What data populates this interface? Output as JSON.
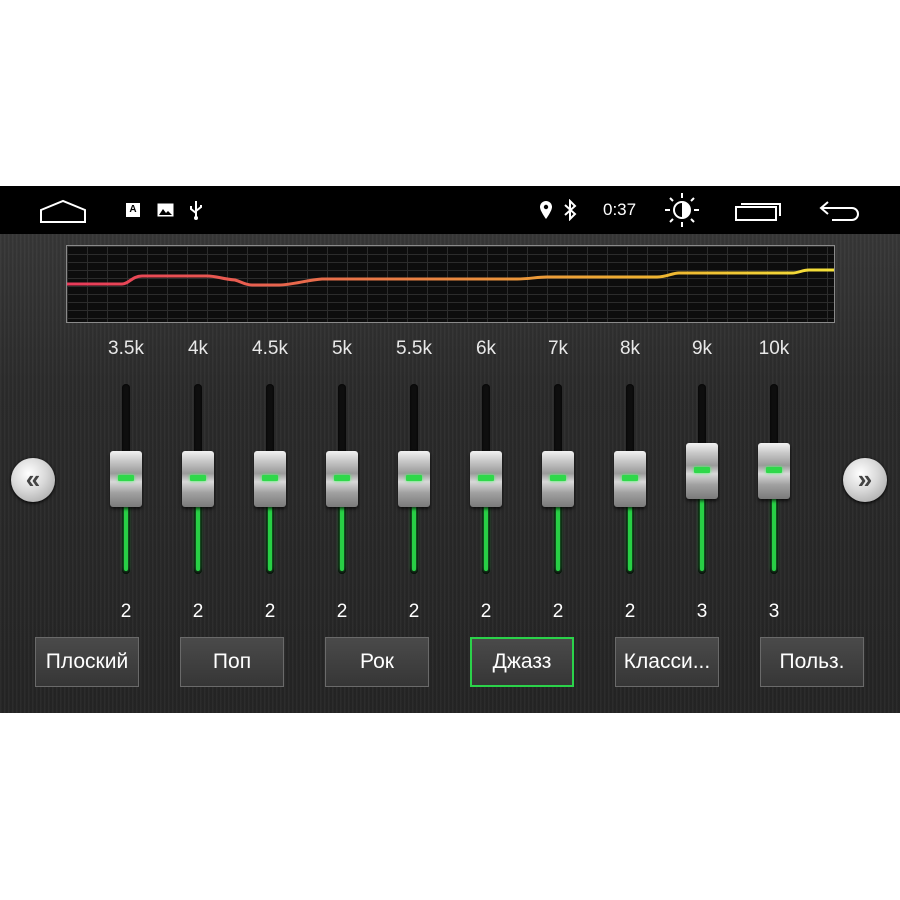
{
  "status_bar": {
    "home_icon": "home-icon",
    "notification_icons": [
      "app-a-icon",
      "image-icon",
      "usb-icon"
    ],
    "location_icon": "location-icon",
    "bluetooth_icon": "bluetooth-icon",
    "time": "0:37",
    "brightness_icon": "brightness-icon",
    "recent_apps_icon": "recent-apps-icon",
    "back_icon": "back-icon",
    "app_a_letter": "A"
  },
  "equalizer": {
    "bands": [
      {
        "freq": "3.5k",
        "value": "2",
        "level": 0.5
      },
      {
        "freq": "4k",
        "value": "2",
        "level": 0.5
      },
      {
        "freq": "4.5k",
        "value": "2",
        "level": 0.5
      },
      {
        "freq": "5k",
        "value": "2",
        "level": 0.5
      },
      {
        "freq": "5.5k",
        "value": "2",
        "level": 0.5
      },
      {
        "freq": "6k",
        "value": "2",
        "level": 0.5
      },
      {
        "freq": "7k",
        "value": "2",
        "level": 0.5
      },
      {
        "freq": "8k",
        "value": "2",
        "level": 0.5
      },
      {
        "freq": "9k",
        "value": "3",
        "level": 0.54
      },
      {
        "freq": "10k",
        "value": "3",
        "level": 0.54
      }
    ],
    "curve_colors": [
      "#e83a5a",
      "#e8704a",
      "#eeb030",
      "#f5e23a"
    ],
    "accent_color": "#2bd24a"
  },
  "navigation": {
    "prev_label": "«",
    "next_label": "»"
  },
  "presets": [
    {
      "label": "Плоский",
      "active": false
    },
    {
      "label": "Поп",
      "active": false
    },
    {
      "label": "Рок",
      "active": false
    },
    {
      "label": "Джазз",
      "active": true
    },
    {
      "label": "Класси...",
      "active": false
    },
    {
      "label": "Польз.",
      "active": false
    }
  ]
}
